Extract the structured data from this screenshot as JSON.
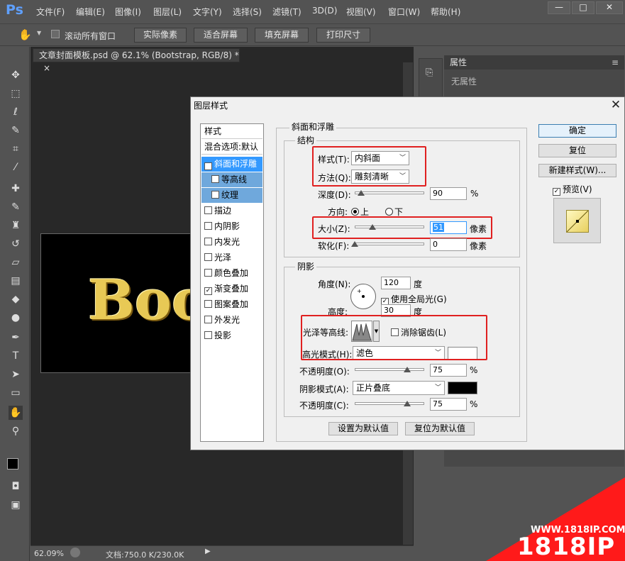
{
  "app": {
    "logo": "Ps"
  },
  "menu": [
    "文件(F)",
    "编辑(E)",
    "图像(I)",
    "图层(L)",
    "文字(Y)",
    "选择(S)",
    "滤镜(T)",
    "3D(D)",
    "视图(V)",
    "窗口(W)",
    "帮助(H)"
  ],
  "window_buttons": {
    "minimize": "—",
    "maximize": "□",
    "close": "✕"
  },
  "options": {
    "scroll_all": "滚动所有窗口",
    "buttons": [
      "实际像素",
      "适合屏幕",
      "填充屏幕",
      "打印尺寸"
    ]
  },
  "document": {
    "tab_title": "文章封面模板.psd @ 62.1% (Bootstrap, RGB/8) *",
    "tab_close": "×",
    "canvas_text": "Boo"
  },
  "status": {
    "zoom": "62.09%",
    "docsize": "文档:750.0 K/230.0K"
  },
  "properties": {
    "title": "属性",
    "body": "无属性"
  },
  "dialog": {
    "title": "图层样式",
    "close": "✕",
    "styles_header": "样式",
    "blend_options": "混合选项:默认",
    "items": [
      {
        "label": "斜面和浮雕",
        "checked": true,
        "sub": false,
        "active": true
      },
      {
        "label": "等高线",
        "checked": false,
        "sub": true,
        "active": false
      },
      {
        "label": "纹理",
        "checked": false,
        "sub": true,
        "active": false
      },
      {
        "label": "描边",
        "checked": false,
        "sub": false,
        "active": false
      },
      {
        "label": "内阴影",
        "checked": false,
        "sub": false,
        "active": false
      },
      {
        "label": "内发光",
        "checked": false,
        "sub": false,
        "active": false
      },
      {
        "label": "光泽",
        "checked": false,
        "sub": false,
        "active": false
      },
      {
        "label": "颜色叠加",
        "checked": false,
        "sub": false,
        "active": false
      },
      {
        "label": "渐变叠加",
        "checked": true,
        "sub": false,
        "active": false
      },
      {
        "label": "图案叠加",
        "checked": false,
        "sub": false,
        "active": false
      },
      {
        "label": "外发光",
        "checked": false,
        "sub": false,
        "active": false
      },
      {
        "label": "投影",
        "checked": false,
        "sub": false,
        "active": false
      }
    ],
    "bevel": {
      "group_title": "斜面和浮雕",
      "structure_title": "结构",
      "style_label": "样式(T):",
      "style_value": "内斜面",
      "method_label": "方法(Q):",
      "method_value": "雕刻清晰",
      "depth_label": "深度(D):",
      "depth_value": "90",
      "depth_unit": "%",
      "depth_level": 0.09,
      "direction_label": "方向:",
      "direction_up": "上",
      "direction_down": "下",
      "size_label": "大小(Z):",
      "size_value": "51",
      "size_unit": "像素",
      "size_level": 0.26,
      "soften_label": "软化(F):",
      "soften_value": "0",
      "soften_unit": "像素",
      "soften_level": 0.0
    },
    "shading": {
      "group_title": "阴影",
      "angle_label": "角度(N):",
      "angle_value": "120",
      "angle_unit": "度",
      "global_light": "使用全局光(G)",
      "altitude_label": "高度:",
      "altitude_value": "30",
      "altitude_unit": "度",
      "gloss_label": "光泽等高线:",
      "antialias": "消除锯齿(L)",
      "highlight_mode_label": "高光模式(H):",
      "highlight_mode_value": "滤色",
      "highlight_color": "#ffffff",
      "opacity1_label": "不透明度(O):",
      "opacity1_value": "75",
      "opacity1_unit": "%",
      "opacity1_level": 0.75,
      "shadow_mode_label": "阴影模式(A):",
      "shadow_mode_value": "正片叠底",
      "shadow_color": "#000000",
      "opacity2_label": "不透明度(C):",
      "opacity2_value": "75",
      "opacity2_unit": "%",
      "opacity2_level": 0.75
    },
    "make_default": "设置为默认值",
    "reset_default": "复位为默认值",
    "ok": "确定",
    "reset": "复位",
    "new_style": "新建样式(W)...",
    "preview": "预览(V)"
  },
  "watermark": {
    "site": "WWW.1818IP.COM",
    "brand": "1818IP"
  }
}
